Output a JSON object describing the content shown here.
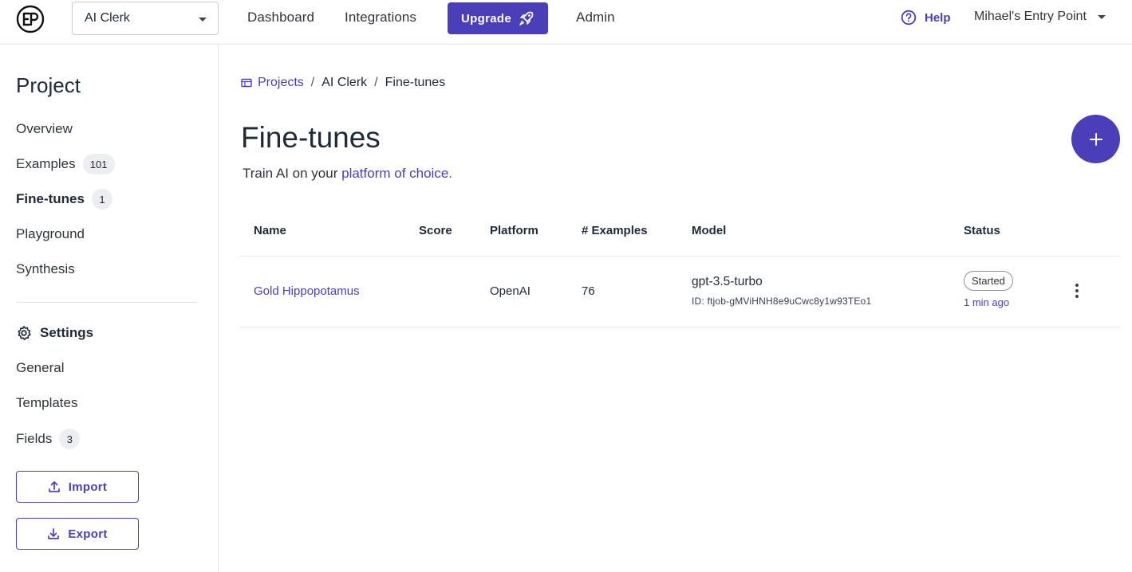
{
  "header": {
    "project_select_value": "AI Clerk",
    "nav": [
      "Dashboard",
      "Integrations",
      "Admin"
    ],
    "upgrade_label": "Upgrade",
    "help_label": "Help",
    "user_label": "Mihael's Entry Point"
  },
  "sidebar": {
    "title": "Project",
    "items": [
      {
        "label": "Overview",
        "badge": ""
      },
      {
        "label": "Examples",
        "badge": "101"
      },
      {
        "label": "Fine-tunes",
        "badge": "1"
      },
      {
        "label": "Playground",
        "badge": ""
      },
      {
        "label": "Synthesis",
        "badge": ""
      }
    ],
    "settings_label": "Settings",
    "settings_items": [
      {
        "label": "General",
        "badge": ""
      },
      {
        "label": "Templates",
        "badge": ""
      },
      {
        "label": "Fields",
        "badge": "3"
      }
    ],
    "import_label": "Import",
    "export_label": "Export"
  },
  "breadcrumb": [
    "Projects",
    "AI Clerk",
    "Fine-tunes"
  ],
  "page": {
    "title": "Fine-tunes",
    "subtitle_prefix": "Train AI on your ",
    "subtitle_link": "platform of choice."
  },
  "table": {
    "headers": [
      "Name",
      "Score",
      "Platform",
      "# Examples",
      "Model",
      "Status"
    ],
    "rows": [
      {
        "name": "Gold Hippopotamus",
        "score": "",
        "platform": "OpenAI",
        "examples": "76",
        "model": "gpt-3.5-turbo",
        "model_id": "ID: ftjob-gMViHNH8e9uCwc8y1w93TEo1",
        "status": "Started",
        "status_time": "1 min ago"
      }
    ]
  },
  "colors": {
    "accent": "#4b3fb9",
    "border": "#e5e7eb"
  }
}
